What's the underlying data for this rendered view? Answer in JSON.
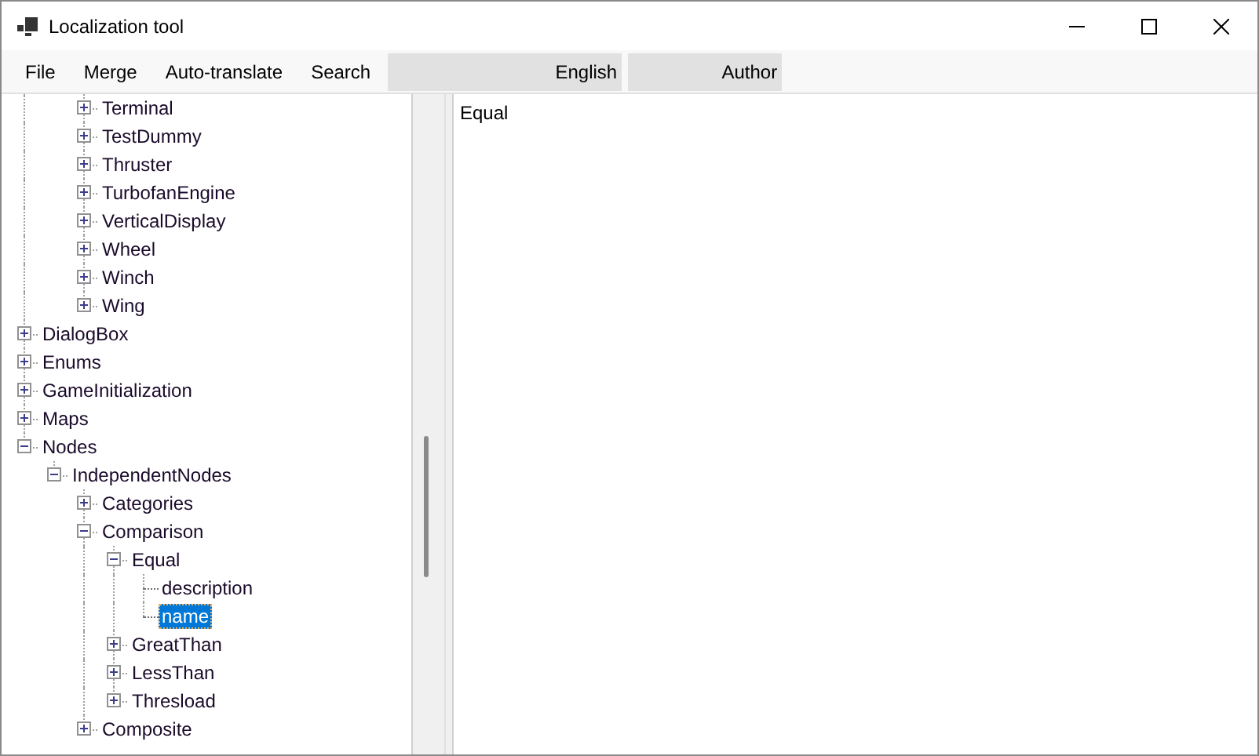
{
  "window": {
    "title": "Localization tool"
  },
  "menu": [
    "File",
    "Merge",
    "Auto-translate",
    "Search"
  ],
  "columns": [
    "English",
    "Author"
  ],
  "tree": {
    "items": [
      {
        "children": [
          {
            "children": [
              {
                "label": "Terminal",
                "kind": "node",
                "expanded": false,
                "selected": false
              },
              {
                "label": "TestDummy",
                "kind": "node",
                "expanded": false,
                "selected": false
              },
              {
                "label": "Thruster",
                "kind": "node",
                "expanded": false,
                "selected": false
              },
              {
                "label": "TurbofanEngine",
                "kind": "node",
                "expanded": false,
                "selected": false
              },
              {
                "label": "VerticalDisplay",
                "kind": "node",
                "expanded": false,
                "selected": false
              },
              {
                "label": "Wheel",
                "kind": "node",
                "expanded": false,
                "selected": false
              },
              {
                "label": "Winch",
                "kind": "node",
                "expanded": false,
                "selected": false
              },
              {
                "label": "Wing",
                "kind": "node",
                "expanded": false,
                "selected": false
              }
            ]
          }
        ]
      },
      {
        "label": "DialogBox",
        "kind": "node",
        "expanded": false,
        "selected": false
      },
      {
        "label": "Enums",
        "kind": "node",
        "expanded": false,
        "selected": false
      },
      {
        "label": "GameInitialization",
        "kind": "node",
        "expanded": false,
        "selected": false
      },
      {
        "label": "Maps",
        "kind": "node",
        "expanded": false,
        "selected": false
      },
      {
        "label": "Nodes",
        "kind": "node",
        "expanded": true,
        "selected": false,
        "children": [
          {
            "label": "IndependentNodes",
            "kind": "node",
            "expanded": true,
            "selected": false,
            "children": [
              {
                "label": "Categories",
                "kind": "node",
                "expanded": false,
                "selected": false
              },
              {
                "label": "Comparison",
                "kind": "node",
                "expanded": true,
                "selected": false,
                "children": [
                  {
                    "label": "Equal",
                    "kind": "node",
                    "expanded": true,
                    "selected": false,
                    "children": [
                      {
                        "label": "description",
                        "kind": "leaf",
                        "selected": false
                      },
                      {
                        "label": "name",
                        "kind": "leaf",
                        "selected": true
                      }
                    ]
                  },
                  {
                    "label": "GreatThan",
                    "kind": "node",
                    "expanded": false,
                    "selected": false
                  },
                  {
                    "label": "LessThan",
                    "kind": "node",
                    "expanded": false,
                    "selected": false
                  },
                  {
                    "label": "Thresload",
                    "kind": "node",
                    "expanded": false,
                    "selected": false
                  }
                ]
              },
              {
                "label": "Composite",
                "kind": "node",
                "expanded": false,
                "selected": false
              }
            ]
          }
        ]
      }
    ]
  },
  "editor": {
    "value": "Equal"
  }
}
